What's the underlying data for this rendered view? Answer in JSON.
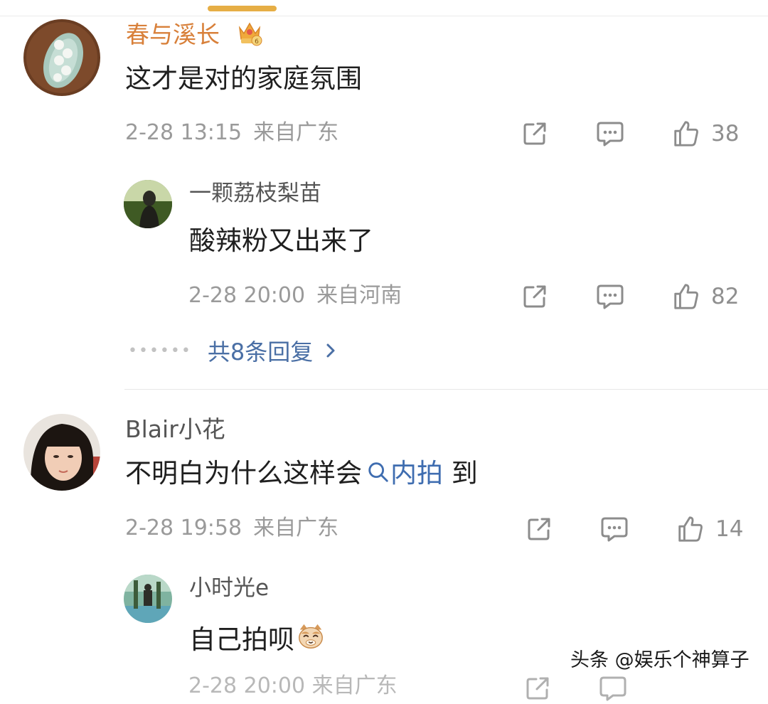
{
  "comments": [
    {
      "user": "春与溪长",
      "badge_level": "6",
      "text": "这才是对的家庭氛围",
      "date": "2-28 13:15",
      "source": "来自广东",
      "likes": "38",
      "replies": [
        {
          "user": "一颗荔枝梨苗",
          "text": "酸辣粉又出来了",
          "date": "2-28 20:00",
          "source": "来自河南",
          "likes": "82"
        }
      ],
      "more_replies_label": "共8条回复"
    },
    {
      "user": "Blair小花",
      "text_prefix": "不明白为什么这样会",
      "topic_link": "内拍",
      "text_suffix": "到",
      "date": "2-28 19:58",
      "source": "来自广东",
      "likes": "14",
      "replies": [
        {
          "user": "小时光e",
          "text": "自己拍呗"
        }
      ]
    }
  ],
  "watermark": "头条 @娱乐个神算子",
  "colors": {
    "accent": "#e6ae45",
    "vip_name": "#d8803a",
    "link": "#3f6db0",
    "meta": "#9a9a9a"
  },
  "icons": [
    "share-icon",
    "comment-icon",
    "like-icon",
    "search-icon",
    "crown-badge-icon",
    "cat-emoji-icon",
    "chevron-right-icon"
  ]
}
